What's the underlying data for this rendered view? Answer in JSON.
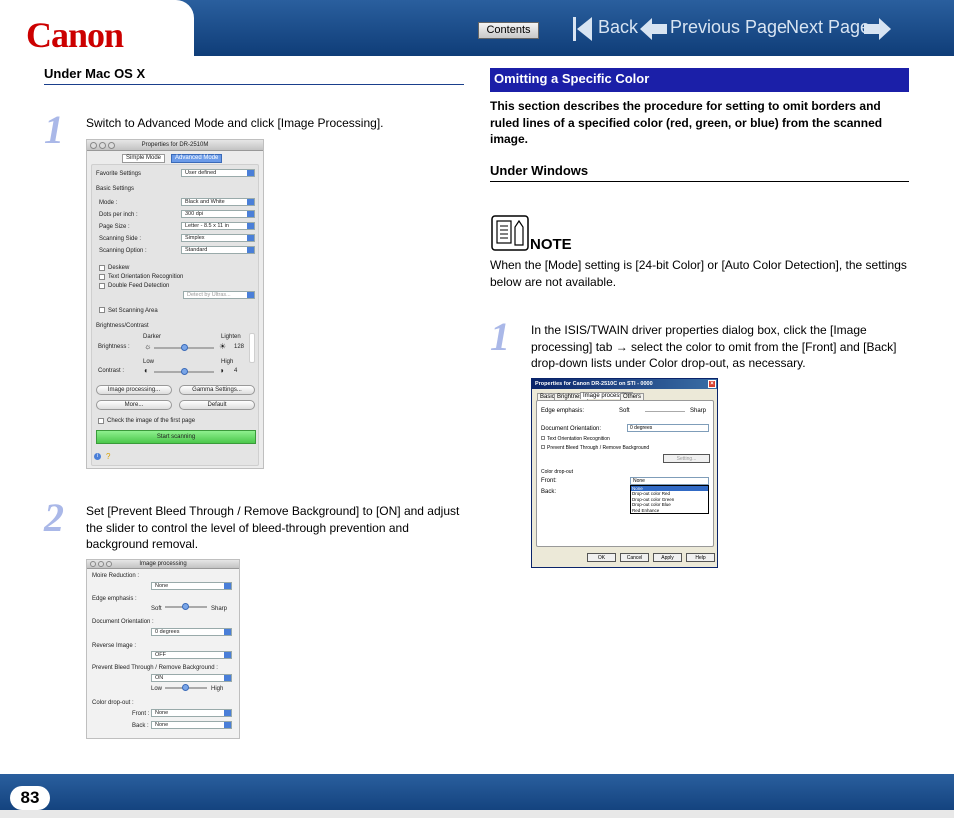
{
  "header": {
    "logo": "Canon",
    "contents_label": "Contents",
    "back_label": "Back",
    "prev_label": "Previous Page",
    "next_label": "Next Page"
  },
  "left": {
    "heading": "Under Mac OS X",
    "step1_num": "1",
    "step1_text": "Switch to Advanced Mode and click [Image Processing].",
    "step2_num": "2",
    "step2_text": "Set [Prevent Bleed Through / Remove Background] to [ON] and adjust the slider to control the level of bleed-through prevention and background removal."
  },
  "mac_dialog1": {
    "title": "Properties for DR-2510M",
    "tab_simple": "Simple Mode",
    "tab_advanced": "Advanced Mode",
    "favorite_label": "Favorite Settings",
    "favorite_value": "User defined",
    "basic_settings": "Basic Settings",
    "mode_label": "Mode :",
    "mode_value": "Black and White",
    "dpi_label": "Dots per inch :",
    "dpi_value": "300 dpi",
    "page_label": "Page Size :",
    "page_value": "Letter - 8.5 x 11 in",
    "side_label": "Scanning Side :",
    "side_value": "Simplex",
    "option_label": "Scanning Option :",
    "option_value": "Standard",
    "deskew": "Deskew",
    "text_orient": "Text Orientation Recognition",
    "double_feed": "Double Feed Detection",
    "detect_by": "Detect by Ultras...",
    "set_area": "Set Scanning Area",
    "bright_contrast": "Brightness/Contrast",
    "darker": "Darker",
    "lighter": "Lighten",
    "brightness_label": "Brightness :",
    "brightness_value": "128",
    "low": "Low",
    "high": "High",
    "contrast_label": "Contrast :",
    "contrast_value": "4",
    "image_processing_btn": "Image processing...",
    "gamma_btn": "Gamma Settings...",
    "more_btn": "More...",
    "default_btn": "Default",
    "check_first": "Check the image of the first page",
    "start_btn": "Start scanning"
  },
  "mac_dialog2": {
    "title": "Image processing",
    "moire_label": "Moire Reduction :",
    "moire_value": "None",
    "edge_label": "Edge emphasis :",
    "soft": "Soft",
    "sharp": "Sharp",
    "doc_orient_label": "Document Orientation :",
    "doc_orient_value": "0 degrees",
    "reverse_label": "Reverse Image :",
    "reverse_value": "OFF",
    "prevent_label": "Prevent Bleed Through / Remove Background :",
    "prevent_value": "ON",
    "low": "Low",
    "high": "High",
    "dropout_label": "Color drop-out :",
    "front_label": "Front :",
    "front_value": "None",
    "back_label": "Back :",
    "back_value": "None"
  },
  "right": {
    "section_title": "Omitting a Specific Color",
    "intro": "This section describes the procedure for setting to omit borders and ruled lines of a specified color (red, green, or blue) from the scanned image.",
    "heading": "Under Windows",
    "note_label": "NOTE",
    "note_text": "When the [Mode] setting is [24-bit Color] or [Auto Color Detection], the settings below are not available.",
    "step1_num": "1",
    "step1_text": "In the ISIS/TWAIN driver properties dialog box, click the [Image processing] tab → select the color to omit from the [Front] and [Back] drop-down lists under Color drop-out, as necessary."
  },
  "win_dialog": {
    "title": "Properties for Canon DR-2510C on STI - 0000",
    "tabs": [
      "Basic",
      "Brightness",
      "Image processing",
      "Others"
    ],
    "edge_label": "Edge emphasis:",
    "soft": "Soft",
    "sharp": "Sharp",
    "doc_orient_label": "Document Orientation:",
    "doc_orient_value": "0 degrees",
    "text_orient": "Text Orientation Recognition",
    "prevent": "Prevent Bleed Through / Remove Background",
    "setting_btn": "Setting...",
    "dropout_label": "Color drop-out",
    "front_label": "Front:",
    "front_value": "None",
    "back_label": "Back:",
    "options": [
      "None",
      "Drop-out color Red",
      "Drop-out color Green",
      "Drop-out color Blue",
      "Red Enhance"
    ],
    "ok": "OK",
    "cancel": "Cancel",
    "apply": "Apply",
    "help": "Help"
  },
  "footer": {
    "page_number": "83"
  }
}
